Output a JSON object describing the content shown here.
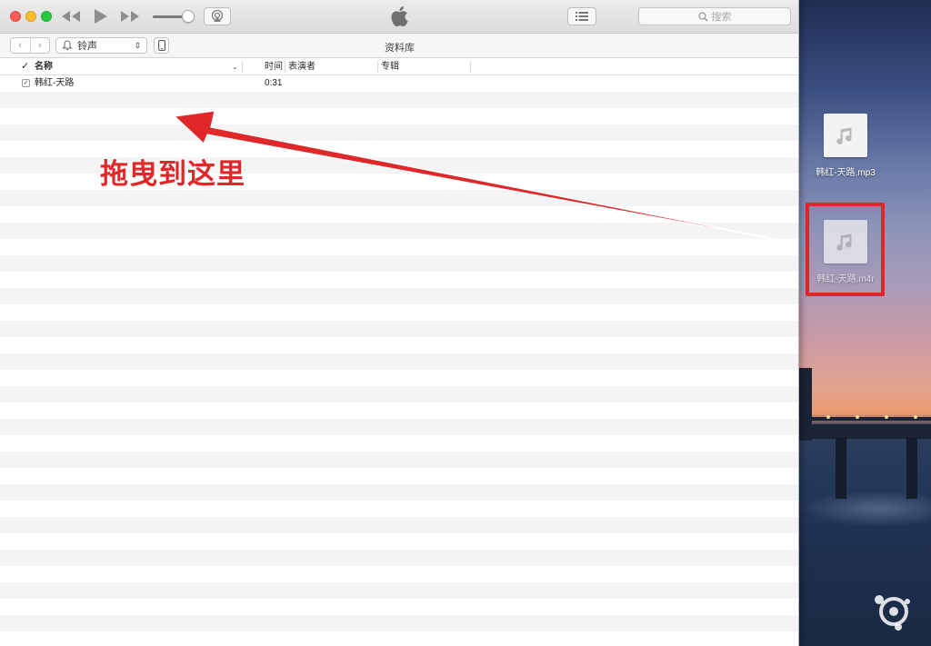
{
  "window": {
    "search_placeholder": "搜索",
    "page_title": "资料库",
    "media_selector_value": "铃声",
    "nav_back": "‹",
    "nav_forward": "›"
  },
  "columns": {
    "check": "✓",
    "name": "名称",
    "time": "时间",
    "artist": "表演者",
    "album": "专辑"
  },
  "rows": [
    {
      "checked": true,
      "name": "韩红-天路",
      "time": "0:31",
      "artist": "",
      "album": ""
    }
  ],
  "desktop": {
    "files": [
      {
        "label": "韩红-天路.mp3"
      },
      {
        "label": "韩红-天路.m4r"
      }
    ]
  },
  "annotation": {
    "text": "拖曳到这里",
    "color": "#e0282a"
  },
  "icons": {
    "rewind": "rewind-icon",
    "play": "play-icon",
    "fast_forward": "fast-forward-icon",
    "airplay": "airplay-icon",
    "apple": "apple-logo-icon",
    "list": "list-view-icon",
    "search": "search-icon",
    "bell": "bell-icon",
    "device": "iphone-icon",
    "music_note": "music-note-icon"
  }
}
